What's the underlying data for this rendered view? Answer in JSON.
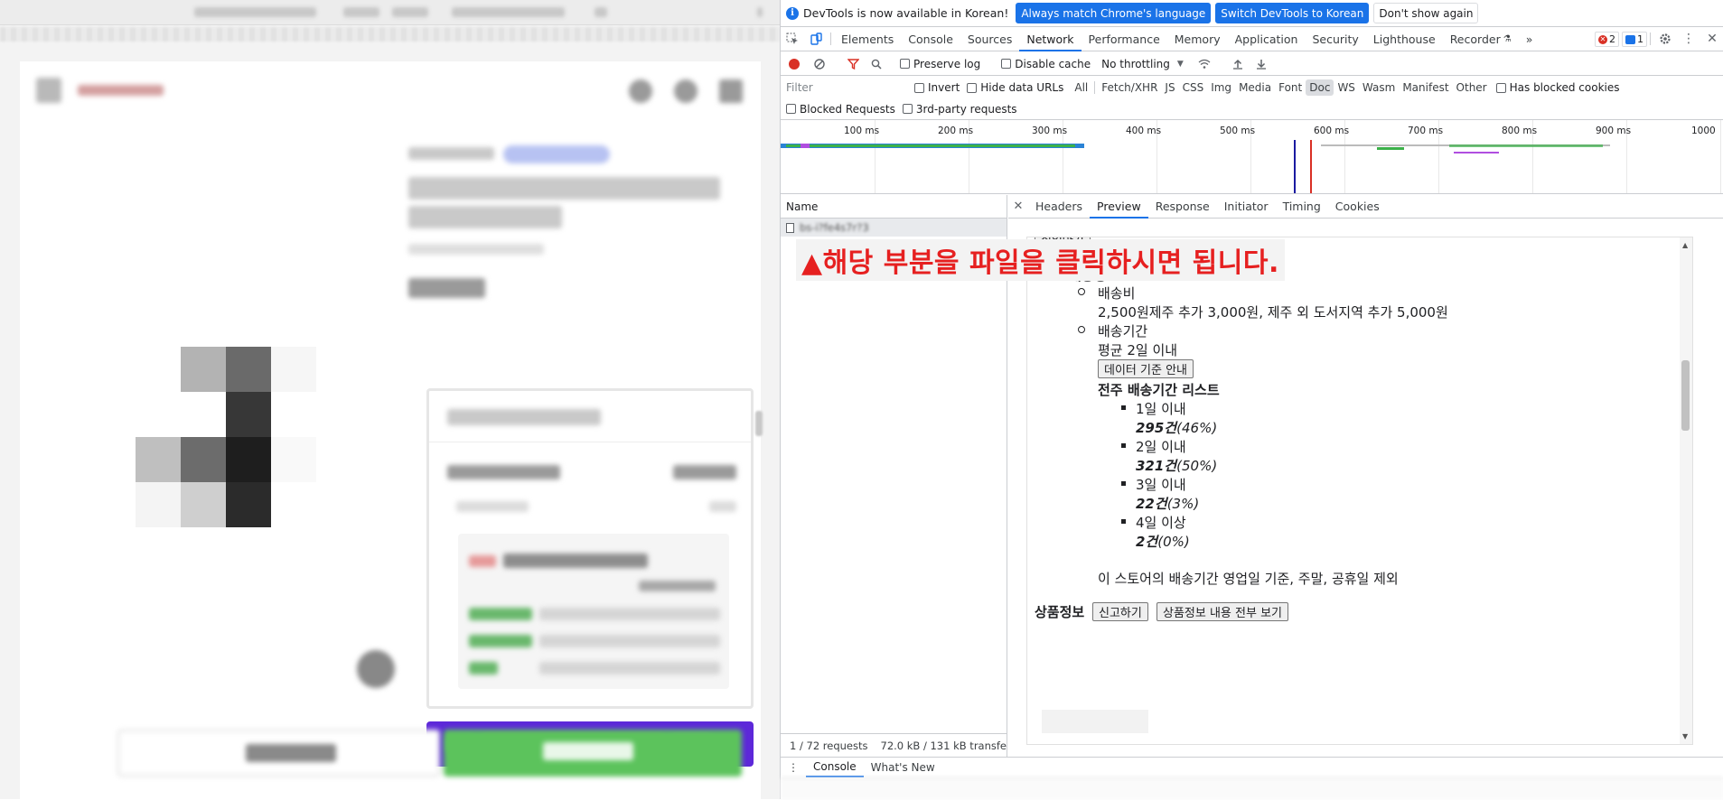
{
  "devtools": {
    "infobar": {
      "message": "DevTools is now available in Korean!",
      "btn_match": "Always match Chrome's language",
      "btn_switch": "Switch DevTools to Korean",
      "btn_dismiss": "Don't show again"
    },
    "tabs": [
      "Elements",
      "Console",
      "Sources",
      "Network",
      "Performance",
      "Memory",
      "Application",
      "Security",
      "Lighthouse",
      "Recorder"
    ],
    "active_tab": "Network",
    "more_tabs": "»",
    "error_count": "2",
    "message_count": "1",
    "toolbar": {
      "preserve_log": "Preserve log",
      "disable_cache": "Disable cache",
      "throttling": "No throttling"
    },
    "filter": {
      "placeholder": "Filter",
      "invert": "Invert",
      "hide_data_urls": "Hide data URLs",
      "types": [
        "All",
        "Fetch/XHR",
        "JS",
        "CSS",
        "Img",
        "Media",
        "Font",
        "Doc",
        "WS",
        "Wasm",
        "Manifest",
        "Other"
      ],
      "selected_type": "Doc",
      "has_blocked_cookies": "Has blocked cookies",
      "blocked_requests": "Blocked Requests",
      "third_party": "3rd-party requests"
    },
    "timeline_ticks": [
      "100 ms",
      "200 ms",
      "300 ms",
      "400 ms",
      "500 ms",
      "600 ms",
      "700 ms",
      "800 ms",
      "900 ms",
      "1000"
    ],
    "name_header": "Name",
    "request_name": "bs-i?fe4s7r?3",
    "status": {
      "requests": "1 / 72 requests",
      "transferred": "72.0 kB / 131 kB transferre"
    },
    "detail_tabs": [
      "Headers",
      "Preview",
      "Response",
      "Initiator",
      "Timing",
      "Cookies"
    ],
    "active_detail_tab": "Preview",
    "preview": {
      "top_btn": "접었아기",
      "section_shipping": "배송정보",
      "shipping_fee_label": "배송비",
      "shipping_fee_value": "2,500원제주 추가 3,000원, 제주 외 도서지역 추가 5,000원",
      "shipping_period_label": "배송기간",
      "avg_period": "평균 2일 이내",
      "data_btn": "데이터 기준 안내",
      "weekly_list_title": "전주 배송기간 리스트",
      "items": [
        {
          "label": "1일 이내",
          "count": "295건",
          "pct": "(46%)"
        },
        {
          "label": "2일 이내",
          "count": "321건",
          "pct": "(50%)"
        },
        {
          "label": "3일 이내",
          "count": "22건",
          "pct": "(3%)"
        },
        {
          "label": "4일 이상",
          "count": "2건",
          "pct": "(0%)"
        }
      ],
      "store_note": "이 스토어의 배송기간 영업일 기준, 주말, 공휴일 제외",
      "product_info": "상품정보",
      "report_btn": "신고하기",
      "view_all_btn": "상품정보 내용 전부 보기"
    },
    "annotation": "▲해당 부분을 파일을 클릭하시면 됩니다.",
    "drawer_tabs": [
      "Console",
      "What's New"
    ]
  },
  "colors": {
    "accent": "#1a73e8",
    "annotation_red": "#e62020",
    "buy_green": "#5cc35c",
    "promo_purple": "#5d28d9"
  }
}
